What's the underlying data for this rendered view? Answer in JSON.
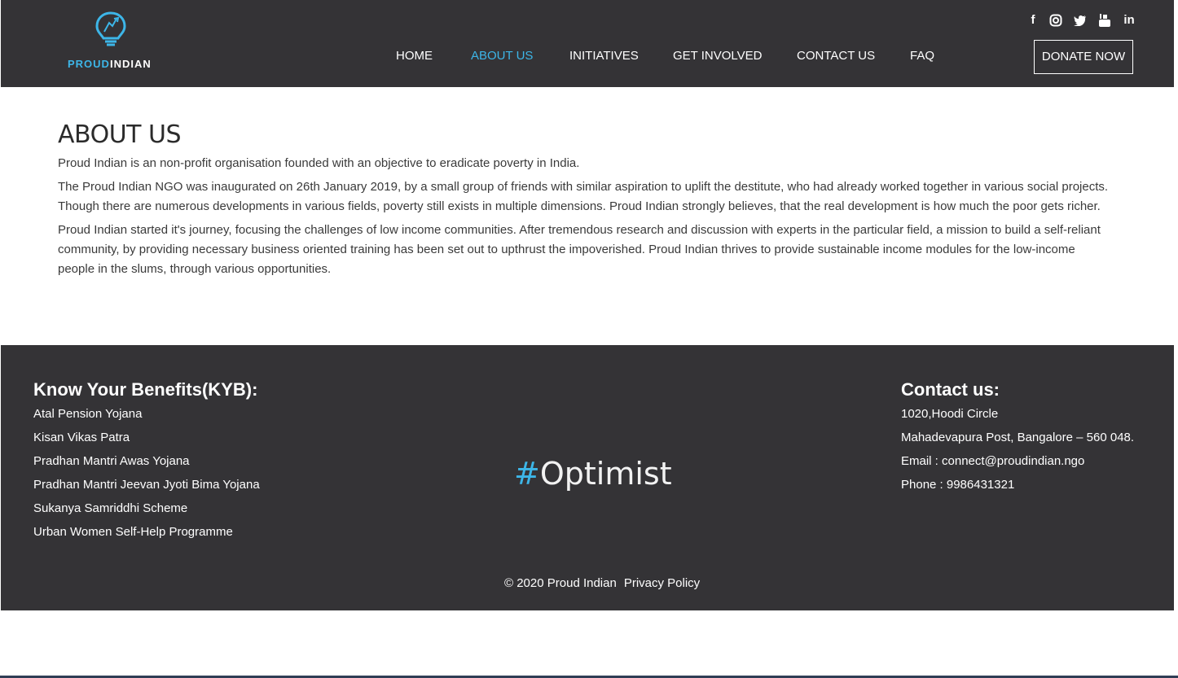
{
  "header": {
    "logo_part1": "PROUD",
    "logo_part2": "INDIAN",
    "nav": [
      {
        "label": "HOME",
        "active": false
      },
      {
        "label": "ABOUT US",
        "active": true
      },
      {
        "label": "INITIATIVES",
        "active": false
      },
      {
        "label": "GET INVOLVED",
        "active": false
      },
      {
        "label": "CONTACT US",
        "active": false
      },
      {
        "label": "FAQ",
        "active": false
      }
    ],
    "social": [
      "facebook-icon",
      "instagram-icon",
      "twitter-icon",
      "youtube-icon",
      "linkedin-icon"
    ],
    "donate_label": "DONATE NOW"
  },
  "main": {
    "title": "ABOUT US",
    "paragraphs": [
      "Proud Indian is an non-profit organisation founded with an objective to eradicate poverty in India.",
      "The Proud Indian NGO was inaugurated on 26th January 2019, by a small group of friends with similar aspiration to uplift the destitute, who had already worked together in various social projects. Though there are numerous developments in various fields, poverty still exists in multiple dimensions. Proud Indian strongly believes, that the real development is how much the poor gets richer.",
      "Proud Indian started it's journey, focusing the challenges of low income communities. After tremendous research and discussion with experts in the particular field, a mission to build a self-reliant community, by providing necessary business oriented training has been set out to upthrust the impoverished. Proud Indian thrives to provide sustainable income modules for the low-income people in the slums, through various opportunities."
    ]
  },
  "footer": {
    "kyb_title": "Know Your Benefits(KYB):",
    "kyb_items": [
      "Atal Pension Yojana",
      "Kisan Vikas Patra",
      "Pradhan Mantri Awas Yojana",
      "Pradhan Mantri Jeevan Jyoti Bima Yojana",
      "Sukanya Samriddhi Scheme",
      "Urban Women Self-Help Programme"
    ],
    "tagline_hash": "#",
    "tagline_word": "Optimist",
    "contact_title": "Contact us:",
    "contact_lines": [
      "1020,Hoodi Circle",
      "Mahadevapura Post, Bangalore – 560 048.",
      "Email : connect@proudindian.ngo",
      "Phone : 9986431321"
    ],
    "copyright": "© 2020 Proud Indian",
    "privacy": "Privacy Policy"
  },
  "colors": {
    "dark_bg": "#343336",
    "accent": "#3db6e8"
  }
}
